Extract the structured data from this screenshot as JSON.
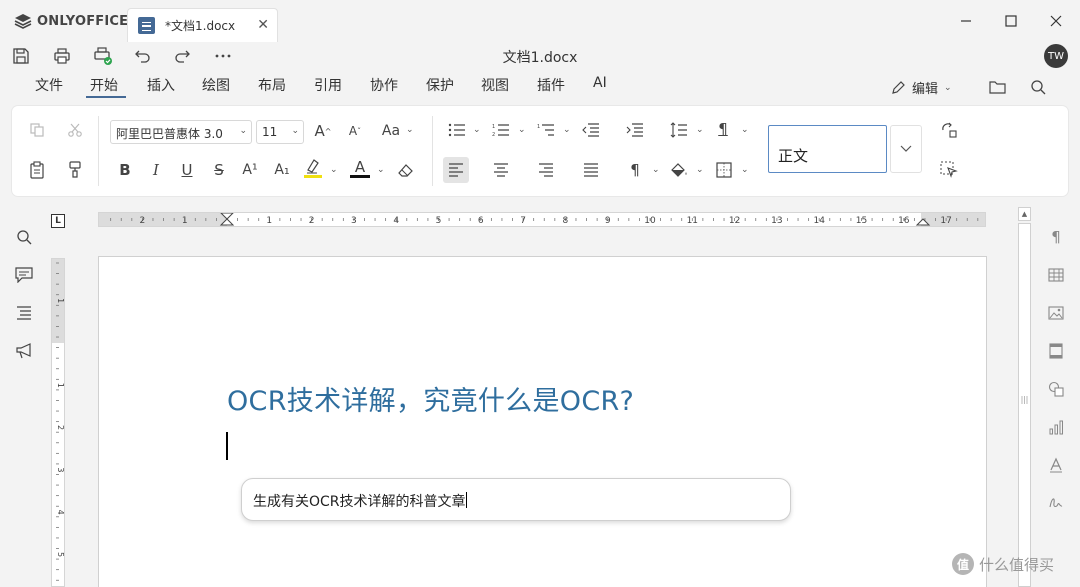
{
  "app": {
    "name": "ONLYOFFICE"
  },
  "tab": {
    "title": "*文档1.docx"
  },
  "document": {
    "title": "文档1.docx",
    "heading": "OCR技术详解，究竟什么是OCR?"
  },
  "user": {
    "initials": "TW"
  },
  "menu": {
    "items": [
      "文件",
      "开始",
      "插入",
      "绘图",
      "布局",
      "引用",
      "协作",
      "保护",
      "视图",
      "插件",
      "AI"
    ],
    "active": "开始",
    "edit_mode": "编辑"
  },
  "toolbar": {
    "font_name": "阿里巴巴普惠体 3.0",
    "font_size": "11",
    "style_name": "正文",
    "grow_font": "A",
    "shrink_font": "A",
    "change_case": "Aa",
    "bold": "B",
    "italic": "I",
    "underline": "U",
    "strike": "S",
    "superscript": "A¹",
    "subscript": "A₁",
    "font_color": "A",
    "highlight_color": "#f0e010",
    "font_color_value": "#111111"
  },
  "ai_prompt": {
    "text": "生成有关OCR技术详解的科普文章"
  },
  "ruler": {
    "corner": "L",
    "ticks": [
      "2",
      "1",
      "1",
      "2",
      "3",
      "4",
      "5",
      "6",
      "7",
      "8",
      "9",
      "10",
      "11",
      "12",
      "13",
      "14",
      "15",
      "16",
      "17"
    ],
    "vticks": [
      "1",
      "1",
      "2",
      "3",
      "4",
      "5"
    ]
  },
  "watermark": {
    "text": "什么值得买",
    "badge": "值"
  },
  "colors": {
    "accent": "#446995",
    "heading": "#2f6e9e"
  }
}
